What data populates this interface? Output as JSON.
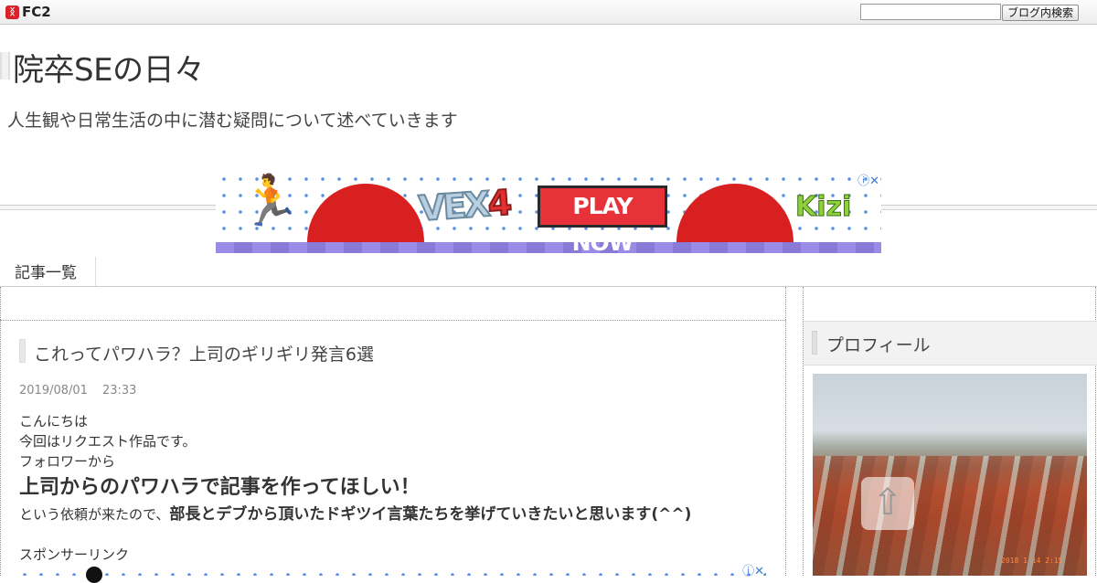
{
  "topbar": {
    "logo_text": "FC2",
    "search_placeholder": "",
    "search_button": "ブログ内検索"
  },
  "header": {
    "title": "院卒SEの日々",
    "description": "人生観や日常生活の中に潜む疑問について述べていきます"
  },
  "ad_banner": {
    "play_label": "PLAY NOW",
    "game_logo": "VEX",
    "game_logo_num": "4",
    "brand": "Kizi",
    "info_icon": "ⓘ✕"
  },
  "nav": {
    "items": [
      {
        "label": "記事一覧"
      }
    ]
  },
  "entry": {
    "title": "これってパワハラ？上司のギリギリ発言6選",
    "date": "2019/08/01",
    "time": "23:33",
    "lines": [
      "こんにちは",
      "今回はリクエスト作品です。",
      "フォロワーから"
    ],
    "headline": "上司からのパワハラで記事を作ってほしい！",
    "mixed_prefix": "という依頼が来たので、",
    "mixed_bold": "部長とデブから頂いたドギツイ言葉たちを挙げていきたいと思います(^^)",
    "sponsor_label": "スポンサーリンク"
  },
  "sidebar": {
    "profile_title": "プロフィール",
    "photo_stamp": "2018 1 14  2:15"
  },
  "colors": {
    "ad_red": "#e8323a",
    "ad_dots": "#5b8fe0",
    "ad_floor": "#9a8be6",
    "kizi_green": "#8ed13c"
  }
}
